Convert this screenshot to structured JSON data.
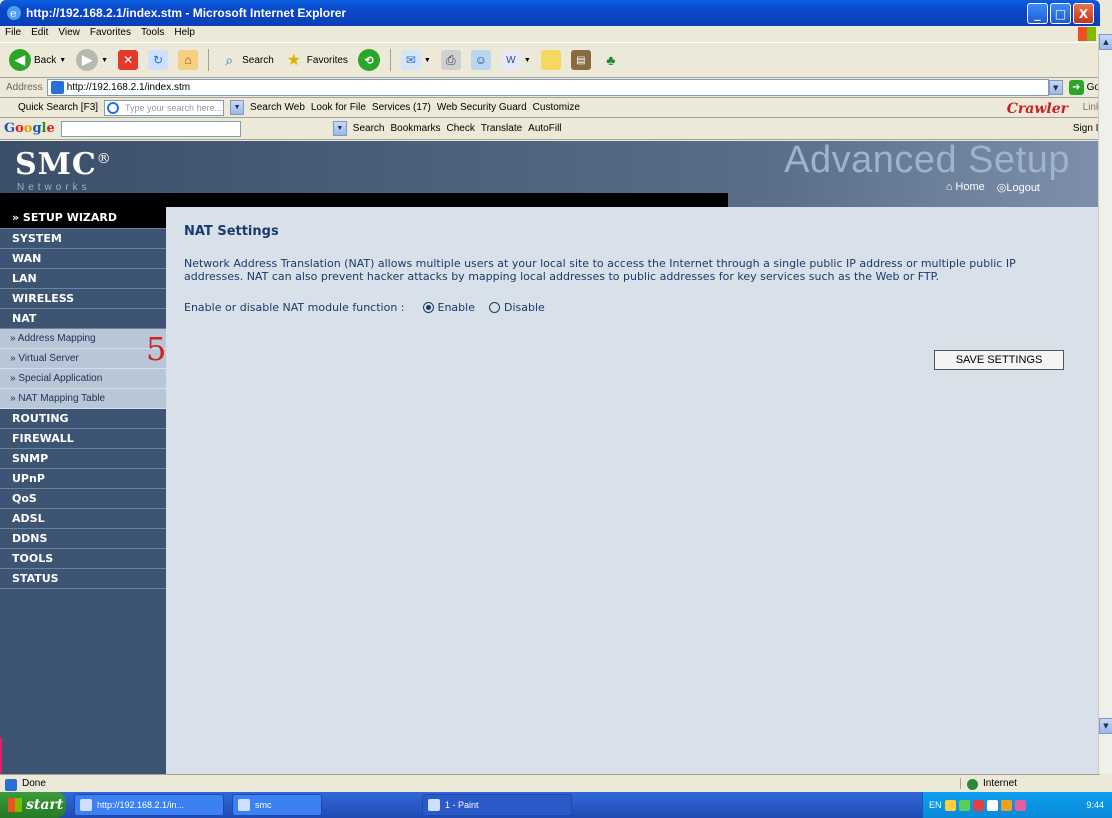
{
  "window": {
    "title": "http://192.168.2.1/index.stm - Microsoft Internet Explorer",
    "buttons": [
      "_",
      "□",
      "X"
    ]
  },
  "menu": [
    "File",
    "Edit",
    "View",
    "Favorites",
    "Tools",
    "Help"
  ],
  "toolbar": {
    "back_label": "Back",
    "search_label": "Search",
    "favorites_label": "Favorites"
  },
  "address": {
    "label": "Address",
    "url": "http://192.168.2.1/index.stm",
    "go_label": "Go"
  },
  "crawler_bar": {
    "quick_search": "Quick Search [F3]",
    "placeholder": "Type your search here...",
    "search_web": "Search Web",
    "look_for_file": "Look for File",
    "services": "Services (17)",
    "web_security_guard": "Web Security Guard",
    "customize": "Customize",
    "logo": "Crawler",
    "links": "Links"
  },
  "google_bar": {
    "logo_b": "G",
    "logo_o1": "o",
    "logo_o2": "o",
    "logo_g": "g",
    "logo_l": "l",
    "logo_e": "e",
    "search": "Search",
    "bookmarks": "Bookmarks",
    "check": "Check",
    "translate": "Translate",
    "autofill": "AutoFill",
    "sign_in": "Sign In"
  },
  "header": {
    "brand": "SMC",
    "brand_mark": "®",
    "networks": "Networks",
    "section": "Advanced Setup",
    "home": "Home",
    "logout": "Logout"
  },
  "sidebar": {
    "wizard": "» SETUP WIZARD",
    "items_top": [
      "SYSTEM",
      "WAN",
      "LAN",
      "WIRELESS",
      "NAT"
    ],
    "nat_sub": [
      "» Address Mapping",
      "» Virtual Server",
      "» Special Application",
      "» NAT Mapping Table"
    ],
    "items_bottom": [
      "ROUTING",
      "FIREWALL",
      "SNMP",
      "UPnP",
      "QoS",
      "ADSL",
      "DDNS",
      "TOOLS",
      "STATUS"
    ]
  },
  "annotation": "5",
  "content": {
    "title": "NAT Settings",
    "description": "Network Address Translation (NAT) allows multiple users at your local site to access the Internet through a single public IP address or multiple public IP addresses. NAT can also prevent hacker attacks by mapping local addresses to public addresses for key services such as the Web or FTP.",
    "nat_label": "Enable or disable NAT module function :",
    "enable": "Enable",
    "disable": "Disable",
    "save": "SAVE SETTINGS"
  },
  "status": {
    "text": "Done",
    "zone": "Internet"
  },
  "taskbar": {
    "start": "start",
    "tasks": [
      "http://192.168.2.1/in...",
      "smc",
      "1 - Paint"
    ],
    "lang": "EN",
    "time": "9:44"
  }
}
